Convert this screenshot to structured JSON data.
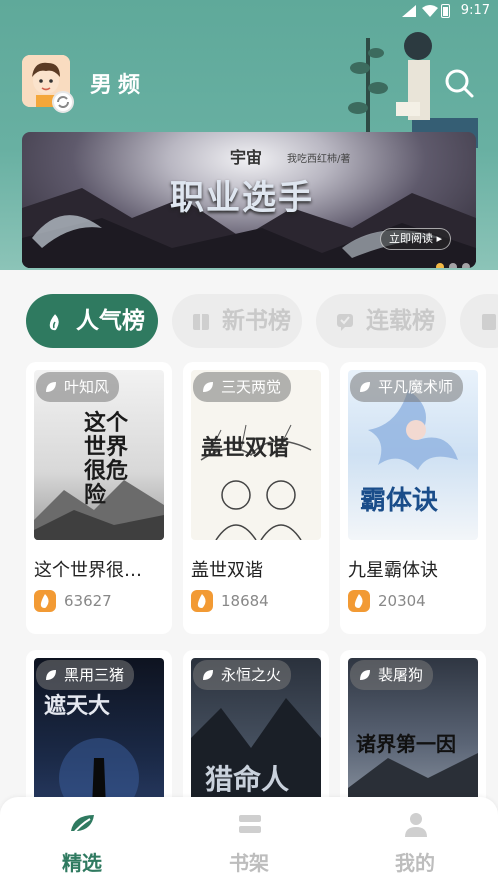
{
  "status_bar": {
    "time": "9:17"
  },
  "header": {
    "channel_title": "男频"
  },
  "banner": {
    "series": "宇宙",
    "title": "职业选手",
    "author": "我吃西红柿/著",
    "read_button": "立即阅读",
    "slide_count": 3,
    "active_slide": 1
  },
  "tabs": [
    {
      "label": "人气榜",
      "active": true
    },
    {
      "label": "新书榜",
      "active": false
    },
    {
      "label": "连载榜",
      "active": false
    }
  ],
  "books": [
    {
      "author": "叶知风",
      "title": "这个世界很…",
      "heat": "63627",
      "cover_text": "这个世界很危险"
    },
    {
      "author": "三天两觉",
      "title": "盖世双谐",
      "heat": "18684",
      "cover_text": "盖世双谐"
    },
    {
      "author": "平凡魔术师",
      "title": "九星霸体诀",
      "heat": "20304",
      "cover_text": "霸体诀"
    },
    {
      "author": "黑用三猪",
      "title": "",
      "heat": "",
      "cover_text": "遮天大"
    },
    {
      "author": "永恒之火",
      "title": "",
      "heat": "",
      "cover_text": "猎命人"
    },
    {
      "author": "裴屠狗",
      "title": "",
      "heat": "",
      "cover_text": "诸界第一因"
    }
  ],
  "bottom_nav": [
    {
      "label": "精选",
      "active": true
    },
    {
      "label": "书架",
      "active": false
    },
    {
      "label": "我的",
      "active": false
    }
  ],
  "colors": {
    "primary": "#2f7a60",
    "header": "#5fa99a",
    "heat": "#f29a34",
    "banner_dot_active": "#f2b844"
  }
}
